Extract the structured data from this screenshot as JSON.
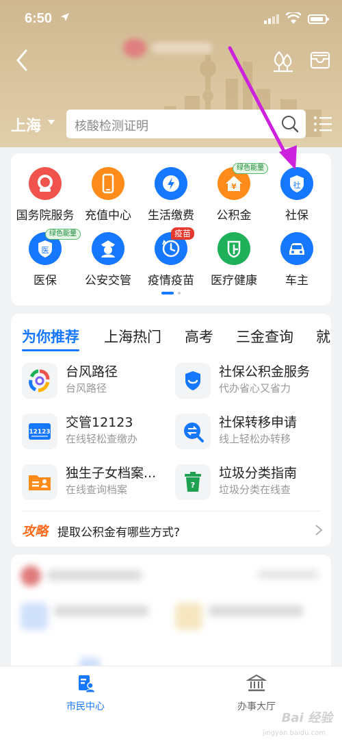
{
  "status_bar": {
    "time": "6:50",
    "location_icon": "location-arrow-icon"
  },
  "header": {
    "city": "上海",
    "search_placeholder": "核酸检测证明",
    "icons": [
      "back-icon",
      "tree-icon",
      "card-holder-icon",
      "search-icon",
      "list-icon"
    ]
  },
  "services": [
    {
      "label": "国务院服务",
      "color": "#f0524c",
      "icon": "state-council-icon"
    },
    {
      "label": "充值中心",
      "color": "#ff8c1a",
      "icon": "phone-icon"
    },
    {
      "label": "生活缴费",
      "color": "#1677ff",
      "icon": "lightning-icon"
    },
    {
      "label": "公积金",
      "color": "#ff8c1a",
      "icon": "house-yuan-icon",
      "badge": "绿色能量"
    },
    {
      "label": "社保",
      "color": "#1677ff",
      "icon": "shield-icon",
      "glyph": "社"
    },
    {
      "label": "医保",
      "color": "#1677ff",
      "icon": "medical-shield-icon",
      "glyph": "医",
      "badge": "绿色能量"
    },
    {
      "label": "公安交管",
      "color": "#1677ff",
      "icon": "police-icon"
    },
    {
      "label": "疫情疫苗",
      "color": "#1677ff",
      "icon": "clock-icon",
      "badge": "疫苗"
    },
    {
      "label": "医疗健康",
      "color": "#1fb15a",
      "icon": "health-icon"
    },
    {
      "label": "车主",
      "color": "#1677ff",
      "icon": "car-icon"
    }
  ],
  "recommend": {
    "tabs": [
      "为你推荐",
      "上海热门",
      "高考",
      "三金查询",
      "就"
    ],
    "items": [
      {
        "title": "台风路径",
        "subtitle": "台风路径",
        "icon": "typhoon-icon"
      },
      {
        "title": "社保公积金服务",
        "subtitle": "代办省心又省力",
        "icon": "shield-smile-icon"
      },
      {
        "title": "交管12123",
        "subtitle": "在线轻松查缴办",
        "icon": "traffic-12123-icon",
        "icon_text": "12123"
      },
      {
        "title": "社保转移申请",
        "subtitle": "线上轻松办转移",
        "icon": "transfer-search-icon"
      },
      {
        "title": "独生子女档案...",
        "subtitle": "在线查询档案",
        "icon": "folder-person-icon"
      },
      {
        "title": "垃圾分类指南",
        "subtitle": "垃圾分类在线查",
        "icon": "trash-bin-icon"
      }
    ],
    "tip_tag": "攻略",
    "tip_text": "提取公积金有哪些方式?"
  },
  "tabbar": {
    "left": "市民中心",
    "right": "办事大厅"
  },
  "watermark": {
    "text": "Bai 经验",
    "sub": "jingyan.baidu.com"
  },
  "colors": {
    "accent": "#1677ff",
    "annotation_arrow": "#cc22dd",
    "header": "#d4be96"
  }
}
